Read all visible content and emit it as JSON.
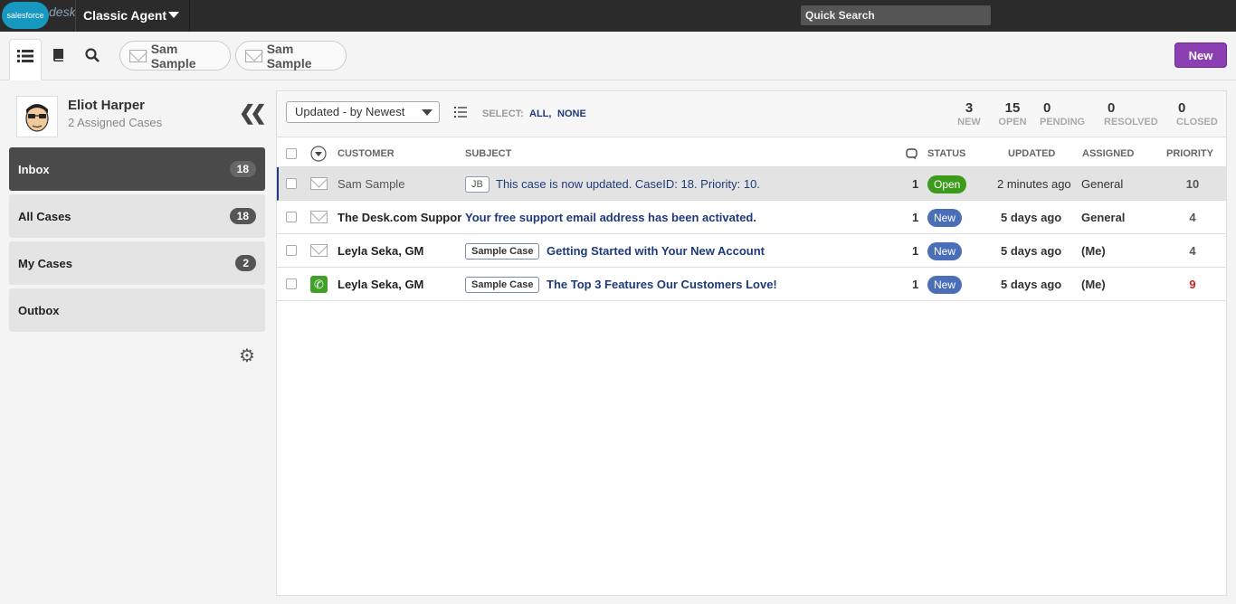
{
  "topbar": {
    "logo_text": "salesforce",
    "logo_desk": "desk",
    "app_title": "Classic Agent",
    "quick_search_placeholder": "Quick Search"
  },
  "toolbar": {
    "tabs": [
      {
        "icon": "list-icon"
      },
      {
        "icon": "book-icon"
      },
      {
        "icon": "search-icon"
      }
    ],
    "open_tabs": [
      {
        "label": "Sam Sample",
        "icon": "envelope-icon"
      },
      {
        "label": "Sam Sample",
        "icon": "envelope-icon"
      }
    ],
    "new_label": "New"
  },
  "sidebar": {
    "agent_name": "Eliot Harper",
    "agent_sub": "2 Assigned Cases",
    "filters": [
      {
        "label": "Inbox",
        "count": "18",
        "active": true
      },
      {
        "label": "All Cases",
        "count": "18"
      },
      {
        "label": "My Cases",
        "count": "2"
      },
      {
        "label": "Outbox",
        "count": ""
      }
    ]
  },
  "main": {
    "sort": "Updated - by Newest",
    "select_label": "SELECT:",
    "select_all": "ALL,",
    "select_none": "NONE",
    "stats": [
      {
        "num": "3",
        "label": "NEW"
      },
      {
        "num": "15",
        "label": "OPEN"
      },
      {
        "num": "0",
        "label": "PENDING"
      },
      {
        "num": "0",
        "label": "RESOLVED"
      },
      {
        "num": "0",
        "label": "CLOSED"
      }
    ],
    "columns": {
      "customer": "CUSTOMER",
      "subject": "SUBJECT",
      "status": "STATUS",
      "updated": "UPDATED",
      "assigned": "ASSIGNED",
      "priority": "PRIORITY"
    },
    "rows": [
      {
        "customer": "Sam Sample",
        "label": "JB",
        "subject": "This case is now updated. CaseID: 18. Priority: 10.",
        "count": "1",
        "status": "Open",
        "updated": "2 minutes ago",
        "assigned": "General",
        "priority": "10",
        "channel": "email"
      },
      {
        "customer": "The Desk.com Support",
        "label": "",
        "subject": "Your free support email address has been activated.",
        "count": "1",
        "status": "New",
        "updated": "5 days ago",
        "assigned": "General",
        "priority": "4",
        "channel": "email"
      },
      {
        "customer": "Leyla Seka, GM",
        "label": "Sample Case",
        "subject": "Getting Started with Your New Account",
        "count": "1",
        "status": "New",
        "updated": "5 days ago",
        "assigned": "(Me)",
        "priority": "4",
        "channel": "email"
      },
      {
        "customer": "Leyla Seka, GM",
        "label": "Sample Case",
        "subject": "The Top 3 Features Our Customers Love!",
        "count": "1",
        "status": "New",
        "updated": "5 days ago",
        "assigned": "(Me)",
        "priority": "9",
        "channel": "phone"
      }
    ],
    "colors": {
      "priority_high": "#cc2222",
      "priority_normal": "#555555",
      "status_open": "#3c9a1c",
      "status_new": "#4a6fb8"
    }
  }
}
